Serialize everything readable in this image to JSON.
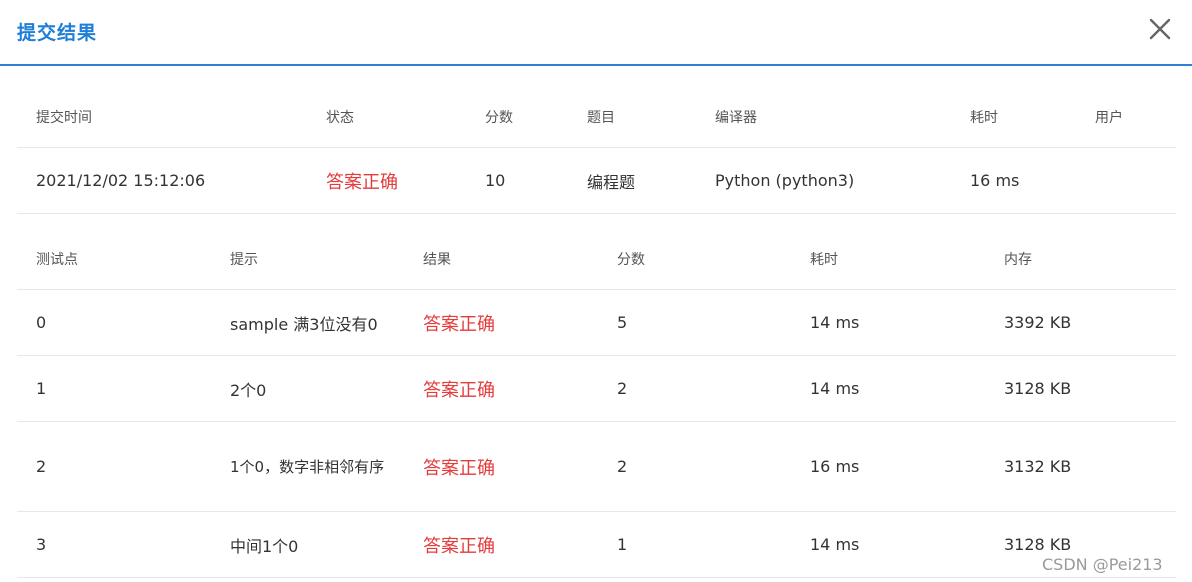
{
  "dialog": {
    "title": "提交结果",
    "close_icon": "close-icon"
  },
  "submission": {
    "headers": {
      "time": "提交时间",
      "status": "状态",
      "score": "分数",
      "problem": "题目",
      "compiler": "编译器",
      "elapsed": "耗时",
      "user": "用户"
    },
    "row": {
      "time": "2021/12/02 15:12:06",
      "status": "答案正确",
      "score": "10",
      "problem": "编程题",
      "compiler": "Python (python3)",
      "elapsed": "16 ms",
      "user": ""
    }
  },
  "testcases": {
    "headers": {
      "case": "测试点",
      "hint": "提示",
      "result": "结果",
      "score": "分数",
      "elapsed": "耗时",
      "memory": "内存"
    },
    "rows": [
      {
        "case": "0",
        "hint": "sample 满3位没有0",
        "result": "答案正确",
        "score": "5",
        "elapsed": "14 ms",
        "memory": "3392 KB"
      },
      {
        "case": "1",
        "hint": "2个0",
        "result": "答案正确",
        "score": "2",
        "elapsed": "14 ms",
        "memory": "3128 KB"
      },
      {
        "case": "2",
        "hint": "1个0，数字非相邻有序",
        "result": "答案正确",
        "score": "2",
        "elapsed": "16 ms",
        "memory": "3132 KB"
      },
      {
        "case": "3",
        "hint": "中间1个0",
        "result": "答案正确",
        "score": "1",
        "elapsed": "14 ms",
        "memory": "3128 KB"
      }
    ]
  },
  "watermark": "CSDN @Pei213",
  "colors": {
    "accent": "#1f7fd6",
    "success_text": "#e53b3b",
    "divider": "#e8e8e8"
  }
}
